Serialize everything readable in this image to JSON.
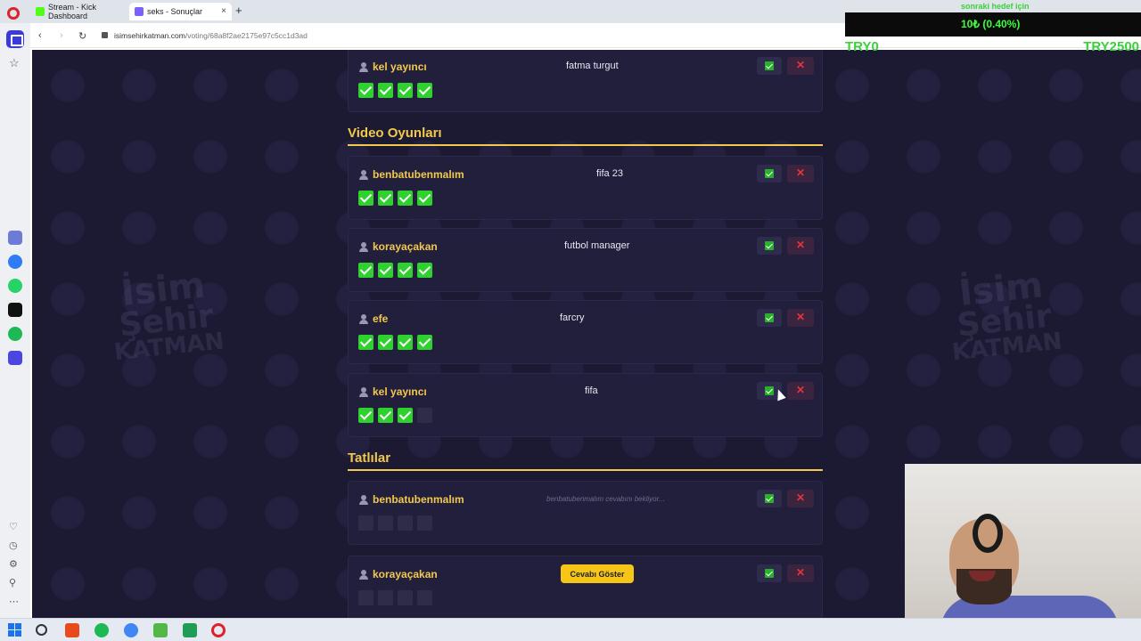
{
  "browser": {
    "tabs": [
      {
        "label": "Stream - Kick Dashboard",
        "favicon_color": "#53fc18"
      },
      {
        "label": "seks - Sonuçlar",
        "favicon_color": "#7b61ff"
      }
    ],
    "url_domain": "isimsehirkatman.com",
    "url_path": "/voting/68a8f2ae2175e97c5cc1d3ad",
    "new_tab_icon": "+",
    "close_icon": "×"
  },
  "colors": {
    "accent": "#f2c94c",
    "page_bg": "#1c1a33",
    "vote_yes": "#2fd12f",
    "reject": "#e8333a",
    "overlay_green": "#3bd13b"
  },
  "watermark": {
    "line1": "İsim",
    "line2": "Şehir",
    "line3": "KATMAN"
  },
  "entries_top": [
    {
      "player": "kel yayıncı",
      "answer": "fatma turgut",
      "votes": [
        true,
        true,
        true,
        true
      ]
    }
  ],
  "categories": [
    {
      "title": "Video Oyunları",
      "entries": [
        {
          "player": "benbatubenmalım",
          "answer": "fifa 23",
          "votes": [
            true,
            true,
            true,
            true
          ]
        },
        {
          "player": "korayaçakan",
          "answer": "futbol manager",
          "votes": [
            true,
            true,
            true,
            true
          ]
        },
        {
          "player": "efe",
          "answer": "farcry",
          "votes": [
            true,
            true,
            true,
            true
          ]
        },
        {
          "player": "kel yayıncı",
          "answer": "fifa",
          "votes": [
            true,
            true,
            true,
            false
          ]
        }
      ]
    },
    {
      "title": "Tatlılar",
      "entries": [
        {
          "player": "benbatubenmalım",
          "waiting": "benbatubenmalım cevabını bekliyor...",
          "votes": [
            false,
            false,
            false,
            false
          ]
        },
        {
          "player": "korayaçakan",
          "reveal_label": "Cevabı Göster",
          "votes": [
            false,
            false,
            false,
            false
          ]
        }
      ]
    }
  ],
  "overlay": {
    "top_text": "sonraki hedef için",
    "progress_text": "10₺ (0.40%)",
    "min_label": "TRY0",
    "max_label": "TRY2500",
    "progress_fraction": 0.004
  }
}
